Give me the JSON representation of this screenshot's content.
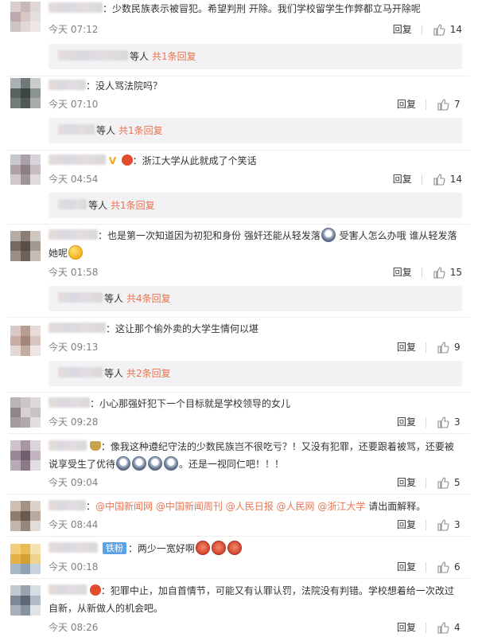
{
  "ui": {
    "reply_label": "回复",
    "sub_mid": "等人",
    "sub_more_prefix": "共",
    "sub_more_suffix": "条回复",
    "fan_badge": "铁粉",
    "colors": {
      "accent": "#eb7350",
      "muted": "#808080",
      "subbox_bg": "#f2f2f5"
    }
  },
  "comments": [
    {
      "text": "：少数民族表示被冒犯。希望判刑 开除。我们学校留学生作弊都立马开除呢",
      "time": "今天 07:12",
      "likes": "14",
      "sub_replies": "1"
    },
    {
      "text": "：没人骂法院吗？",
      "time": "今天 07:10",
      "likes": "7",
      "sub_replies": "1"
    },
    {
      "text": "：浙江大学从此就成了个笑话",
      "time": "今天 04:54",
      "likes": "14",
      "sub_replies": "1"
    },
    {
      "text_a": "：也是第一次知道因为初犯和身份 强奸还能从轻发落",
      "text_b": " 受害人怎么办哦 谁从轻发落",
      "text_c": "她呢",
      "time": "今天 01:58",
      "likes": "15",
      "sub_replies": "4"
    },
    {
      "text": "：这让那个偷外卖的大学生情何以堪",
      "time": "今天 09:13",
      "likes": "9",
      "sub_replies": "2"
    },
    {
      "text": "：小心那强奸犯下一个目标就是学校领导的女儿",
      "time": "今天 09:28",
      "likes": "3"
    },
    {
      "text_a": "：像我这种遵纪守法的少数民族岂不很吃亏？！又没有犯罪，还要跟着被骂，还要被",
      "text_b": "说享受生了优待",
      "text_c": "。还是一视同仁吧！！！",
      "time": "今天 09:04",
      "likes": "5"
    },
    {
      "prefix": "：",
      "mentions": [
        "@中国新闻网",
        "@中国新闻周刊",
        "@人民日报",
        "@人民网",
        "@浙江大学"
      ],
      "suffix": " 请出面解释。",
      "time": "今天 08:44",
      "likes": "3"
    },
    {
      "text": "：两少一宽好啊",
      "time": "今天 00:18",
      "likes": "6"
    },
    {
      "text_a": "：犯罪中止，加自首情节，可能又有认罪认罚，法院没有判错。学校想着给一次改过",
      "text_b": "自新，从新做人的机会吧。",
      "time": "今天 08:26",
      "likes": "4"
    }
  ]
}
